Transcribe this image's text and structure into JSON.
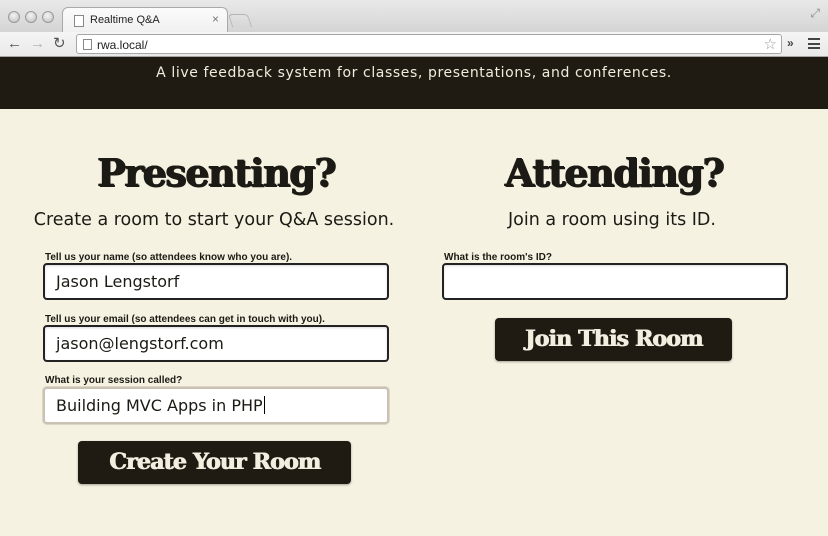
{
  "browser": {
    "tab_title": "Realtime Q&A",
    "url": "rwa.local/"
  },
  "header": {
    "tagline": "A live feedback system for classes, presentations, and conferences."
  },
  "presenting": {
    "heading": "Presenting?",
    "subheading": "Create a room to start your Q&A session.",
    "name_label": "Tell us your name (so attendees know who you are).",
    "name_value": "Jason Lengstorf",
    "email_label": "Tell us your email (so attendees can get in touch with you).",
    "email_value": "jason@lengstorf.com",
    "session_label": "What is your session called?",
    "session_value": "Building MVC Apps in PHP",
    "button_label": "Create Your Room"
  },
  "attending": {
    "heading": "Attending?",
    "subheading": "Join a room using its ID.",
    "room_label": "What is the room's ID?",
    "room_value": "",
    "button_label": "Join This Room"
  }
}
